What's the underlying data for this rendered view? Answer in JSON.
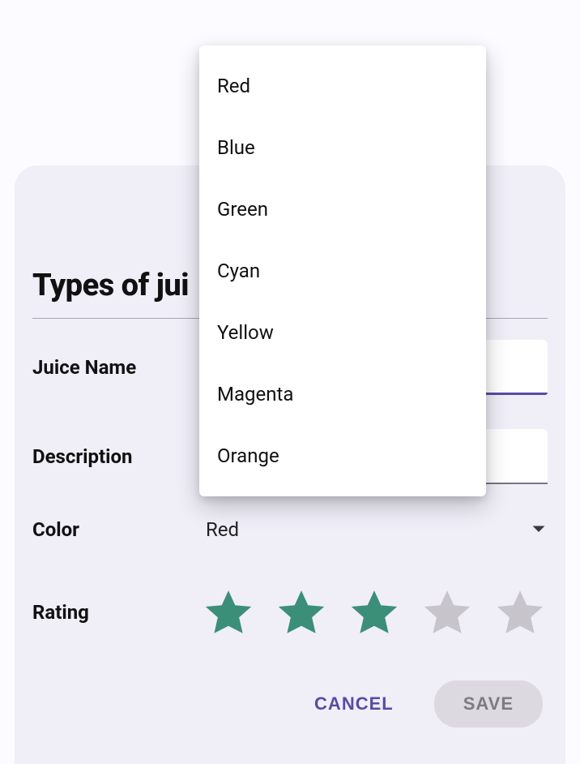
{
  "title": "Types of jui",
  "fields": {
    "juice_name": {
      "label": "Juice Name",
      "value": ""
    },
    "description": {
      "label": "Description",
      "value": ""
    },
    "color": {
      "label": "Color",
      "selected": "Red"
    },
    "rating": {
      "label": "Rating",
      "value": 3,
      "max": 5
    }
  },
  "dropdown_options": [
    "Red",
    "Blue",
    "Green",
    "Cyan",
    "Yellow",
    "Magenta",
    "Orange"
  ],
  "actions": {
    "cancel": "CANCEL",
    "save": "SAVE"
  },
  "colors": {
    "accent": "#5b4aa3",
    "star_filled": "#3b8f78",
    "star_empty": "#c7c5cb"
  }
}
